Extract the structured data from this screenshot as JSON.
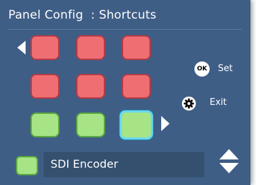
{
  "header": {
    "title": "Panel Config  : Shortcuts"
  },
  "grid": {
    "buttons": [
      {
        "id": "r1c1",
        "color": "red"
      },
      {
        "id": "r1c2",
        "color": "red"
      },
      {
        "id": "r1c3",
        "color": "red"
      },
      {
        "id": "r2c1",
        "color": "red"
      },
      {
        "id": "r2c2",
        "color": "red"
      },
      {
        "id": "r2c3",
        "color": "red"
      },
      {
        "id": "r3c1",
        "color": "green"
      },
      {
        "id": "r3c2",
        "color": "green"
      },
      {
        "id": "r3c3",
        "color": "green",
        "selected": true
      }
    ]
  },
  "actions": {
    "ok_icon_text": "OK",
    "set_label": "Set",
    "exit_label": "Exit",
    "exit_icon": "gear-icon"
  },
  "footer": {
    "selected_name": "SDI Encoder"
  },
  "colors": {
    "panel_bg": "#3f5e86",
    "red_fill": "#ee6e72",
    "green_fill": "#a6e485",
    "selected_outline": "#6ad9f0"
  }
}
